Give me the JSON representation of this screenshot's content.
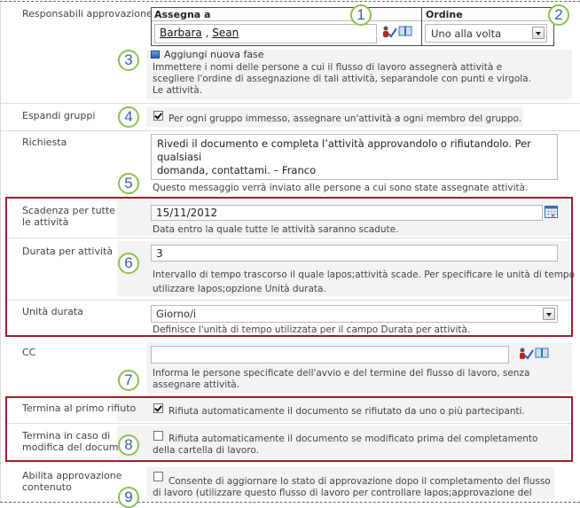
{
  "approvers": {
    "label": "Responsabili approvazione",
    "col_assign": "Assegna a",
    "col_order": "Ordine",
    "people": [
      "Barbara",
      "Sean"
    ],
    "separator": " , ",
    "order_value": "Uno alla volta",
    "add_stage": "Aggiungi nuova fase",
    "description": [
      "Immettere i nomi delle persone a cui il flusso di lavoro assegnerà attività e",
      "scegliere l'ordine di assegnazione di tali attività, separandole con punti e virgola.",
      "Le attività."
    ]
  },
  "expand_groups": {
    "label": "Espandi gruppi",
    "checked": true,
    "text": "Per ogni gruppo immesso, assegnare un'attività a ogni membro del gruppo."
  },
  "request": {
    "label": "Richiesta",
    "value_lines": [
      "Rivedi il documento e completa l’attività approvandolo o rifiutandolo. Per qualsiasi",
      "domanda, contattami. – Franco"
    ],
    "description": "Questo messaggio verrà inviato alle persone a cui sono state assegnate attività."
  },
  "due_date": {
    "label_lines": [
      "Scadenza per tutte",
      "le attività"
    ],
    "value": "15/11/2012",
    "description": "Data entro la quale tutte le attività saranno scadute."
  },
  "duration": {
    "label": "Durata per attività",
    "value": "3",
    "description": [
      "Intervallo di tempo trascorso il quale lapos;attività scade. Per specificare le unità di tempo",
      "utilizzare lapos;opzione Unità durata."
    ]
  },
  "duration_units": {
    "label": "Unità durata",
    "value": "Giorno/i",
    "description": "Definisce l'unità di tempo utilizzata per il campo Durata per attività."
  },
  "cc": {
    "label": "CC",
    "value": "",
    "description": [
      "Informa le persone specificate dell'avvio e del termine del flusso di lavoro, senza",
      "assegnare attività."
    ]
  },
  "end_first_reject": {
    "label": "Termina al primo rifiuto",
    "checked": true,
    "text": "Rifiuta automaticamente il documento se rifiutato da uno o più partecipanti."
  },
  "end_on_change": {
    "label_lines": [
      "Termina in caso di",
      "modifica del documen"
    ],
    "checked": false,
    "text": [
      "Rifiuta automaticamente il documento se modificato prima del completamento",
      "della cartella di lavoro."
    ]
  },
  "content_approval": {
    "label_lines": [
      "Abilita approvazione",
      "contenuto"
    ],
    "checked": false,
    "text": [
      "Consente di aggiornare lo stato di approvazione dopo il completamento del flusso",
      "di lavoro (utilizzare questo flusso di lavoro per controllare lapos;approvazione del"
    ]
  },
  "callouts": [
    "1",
    "2",
    "3",
    "4",
    "5",
    "6",
    "7",
    "8",
    "9"
  ],
  "colors": {
    "callout_ring": "#8cc152",
    "callout_number": "#3a5fa8",
    "highlight_box": "#a31b2b"
  }
}
